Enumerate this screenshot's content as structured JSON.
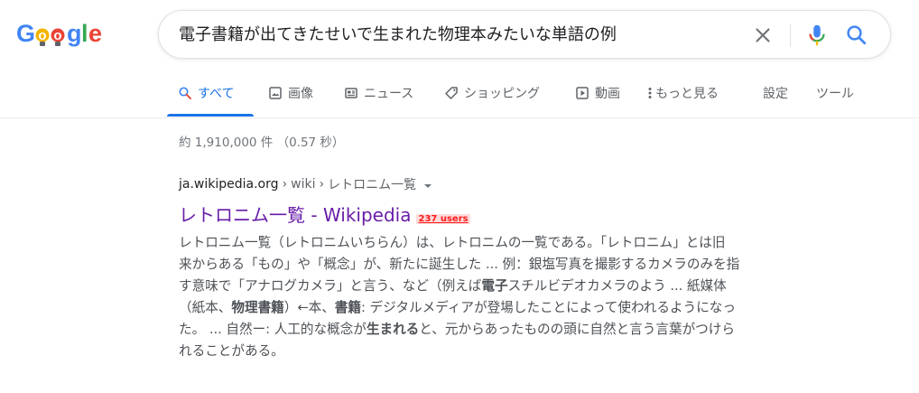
{
  "logo": {
    "letters": [
      "G",
      "o",
      "o",
      "g",
      "l",
      "e"
    ]
  },
  "search": {
    "query": "電子書籍が出てきたせいで生まれた物理本みたいな単語の例"
  },
  "tabs": [
    {
      "label": "すべて",
      "icon": "search-icon"
    },
    {
      "label": "画像",
      "icon": "image-icon"
    },
    {
      "label": "ニュース",
      "icon": "news-icon"
    },
    {
      "label": "ショッピング",
      "icon": "tag-icon"
    },
    {
      "label": "動画",
      "icon": "play-icon"
    },
    {
      "label": "もっと見る",
      "icon": "more-vert-icon"
    },
    {
      "label": "設定"
    },
    {
      "label": "ツール"
    }
  ],
  "stats": "約 1,910,000 件 （0.57 秒）",
  "result": {
    "site": "ja.wikipedia.org",
    "sep1": "›",
    "path1": "wiki",
    "sep2": "›",
    "path2": "レトロニム一覧",
    "title": "レトロニム一覧 - Wikipedia",
    "users": "237 users",
    "snippet": [
      [
        {
          "t": "レトロニム一覧（レトロニムいちらん）は、レトロニムの一覧である。「レトロニム」とは旧"
        }
      ],
      [
        {
          "t": "来からある「もの」や「概念」が、新たに誕生した ... 例：銀塩写真を撮影するカメラのみを指"
        }
      ],
      [
        {
          "t": "す意味で「アナログカメラ」と言う、など（例えば"
        },
        {
          "t": "電子",
          "b": true
        },
        {
          "t": "スチルビデオカメラのよう ... 紙媒体"
        }
      ],
      [
        {
          "t": "（紙本、"
        },
        {
          "t": "物理書籍",
          "b": true
        },
        {
          "t": "）←本、"
        },
        {
          "t": "書籍",
          "b": true
        },
        {
          "t": ": デジタルメディアが登場したことによって使われるようになっ"
        }
      ],
      [
        {
          "t": "た。 ... 自然ー: 人工的な概念が"
        },
        {
          "t": "生まれる",
          "b": true
        },
        {
          "t": "と、元からあったものの頭に自然と言う言葉がつけら"
        }
      ],
      [
        {
          "t": "れることがある。"
        }
      ]
    ]
  },
  "colors": {
    "tab_active": "#1a73e8",
    "link_visited": "#681da8",
    "badge": "#ff1a1a"
  }
}
